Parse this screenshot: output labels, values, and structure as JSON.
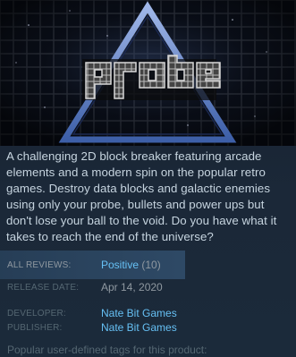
{
  "capsule": {
    "logo_text": "probe"
  },
  "description": "A challenging 2D block breaker featuring arcade elements and a modern spin on the popular retro games. Destroy data blocks and galactic enemies using only your probe, bullets and power ups but don't lose your ball to the void. Do you have what it takes to reach the end of the universe?",
  "reviews": {
    "label": "ALL REVIEWS:",
    "summary": "Positive",
    "count": "(10)"
  },
  "release": {
    "label": "RELEASE DATE:",
    "date": "Apr 14, 2020"
  },
  "developer": {
    "label": "DEVELOPER:",
    "name": "Nate Bit Games"
  },
  "publisher": {
    "label": "PUBLISHER:",
    "name": "Nate Bit Games"
  },
  "tags_heading": "Popular user-defined tags for this product:",
  "colors": {
    "background": "#1b2838",
    "link": "#66c0f4",
    "text": "#c6d4df",
    "muted": "#556772"
  }
}
